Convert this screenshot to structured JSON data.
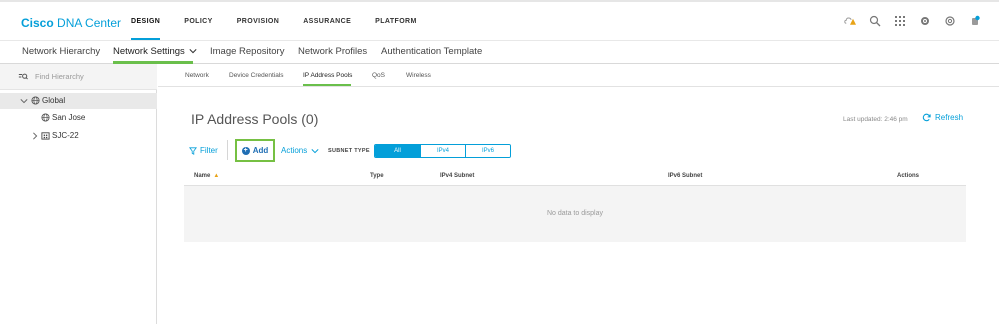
{
  "app": {
    "logo_brand": "Cisco",
    "logo_product": "DNA Center"
  },
  "top_nav": {
    "items": [
      "DESIGN",
      "POLICY",
      "PROVISION",
      "ASSURANCE",
      "PLATFORM"
    ],
    "active": "DESIGN"
  },
  "top_icons": [
    "alert-icon",
    "search-icon",
    "apps-grid-icon",
    "settings-icon",
    "help-icon",
    "notifications-icon"
  ],
  "sub_nav": {
    "items": [
      "Network Hierarchy",
      "Network Settings",
      "Image Repository",
      "Network Profiles",
      "Authentication Template"
    ],
    "active": "Network Settings"
  },
  "sidebar": {
    "search_placeholder": "Find Hierarchy",
    "tree": [
      {
        "label": "Global",
        "level": 0,
        "expanded": true,
        "selected": true,
        "icon": "globe-icon"
      },
      {
        "label": "San Jose",
        "level": 1,
        "icon": "area-icon"
      },
      {
        "label": "SJC-22",
        "level": 1,
        "expandable": true,
        "icon": "building-icon"
      }
    ]
  },
  "tabs": {
    "items": [
      "Network",
      "Device Credentials",
      "IP Address Pools",
      "QoS",
      "Wireless"
    ],
    "active": "IP Address Pools"
  },
  "main": {
    "title": "IP Address Pools (0)",
    "last_updated": "Last updated: 2:46 pm",
    "refresh_label": "Refresh",
    "filter_label": "Filter",
    "add_label": "Add",
    "actions_label": "Actions",
    "subnet_type_label": "SUBNET TYPE",
    "subnet_options": [
      "All",
      "IPv4",
      "IPv6"
    ],
    "subnet_active": "All",
    "table": {
      "columns": [
        "Name",
        "Type",
        "IPv4 Subnet",
        "IPv6 Subnet",
        "Actions"
      ],
      "sorted_column": "Name",
      "empty_message": "No data to display"
    }
  },
  "colors": {
    "accent": "#049fd9",
    "highlight_green": "#76c043",
    "add_blue": "#1f6eb4",
    "warning": "#e8a317"
  }
}
